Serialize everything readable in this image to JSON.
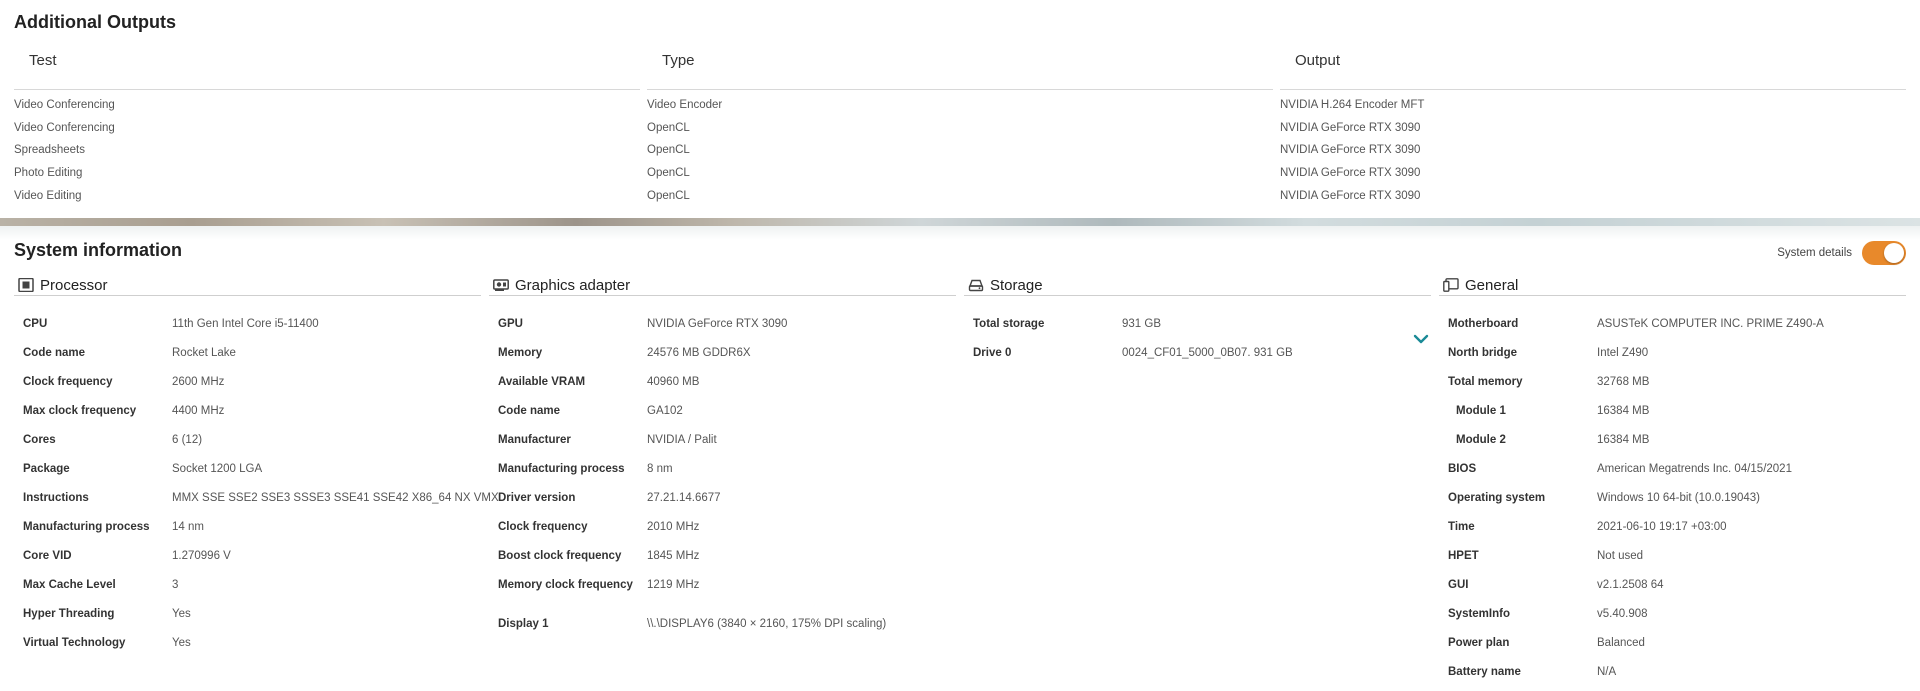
{
  "additional_outputs": {
    "title": "Additional Outputs",
    "headers": [
      "Test",
      "Type",
      "Output"
    ],
    "rows": [
      {
        "test": "Video Conferencing",
        "type": "Video Encoder",
        "output": "NVIDIA H.264 Encoder MFT"
      },
      {
        "test": "Video Conferencing",
        "type": "OpenCL",
        "output": "NVIDIA GeForce RTX 3090"
      },
      {
        "test": "Spreadsheets",
        "type": "OpenCL",
        "output": "NVIDIA GeForce RTX 3090"
      },
      {
        "test": "Photo Editing",
        "type": "OpenCL",
        "output": "NVIDIA GeForce RTX 3090"
      },
      {
        "test": "Video Editing",
        "type": "OpenCL",
        "output": "NVIDIA GeForce RTX 3090"
      }
    ]
  },
  "system_info": {
    "title": "System information",
    "details_toggle_label": "System details",
    "details_toggle_on": true,
    "accent_color": "#e8892b",
    "processor": {
      "title": "Processor",
      "icon": "cpu-icon",
      "rows": [
        {
          "k": "CPU",
          "v": "11th Gen Intel Core i5-11400"
        },
        {
          "k": "Code name",
          "v": "Rocket Lake"
        },
        {
          "k": "Clock frequency",
          "v": "2600 MHz"
        },
        {
          "k": "Max clock frequency",
          "v": "4400 MHz"
        },
        {
          "k": "Cores",
          "v": "6 (12)"
        },
        {
          "k": "Package",
          "v": "Socket 1200 LGA"
        },
        {
          "k": "Instructions",
          "v": "MMX SSE SSE2 SSE3 SSSE3 SSE41 SSE42 X86_64 NX VMX"
        },
        {
          "k": "Manufacturing process",
          "v": "14 nm"
        },
        {
          "k": "Core VID",
          "v": "1.270996 V"
        },
        {
          "k": "Max Cache Level",
          "v": "3"
        },
        {
          "k": "Hyper Threading",
          "v": "Yes"
        },
        {
          "k": "Virtual Technology",
          "v": "Yes"
        }
      ]
    },
    "graphics": {
      "title": "Graphics adapter",
      "icon": "gpu-icon",
      "rows": [
        {
          "k": "GPU",
          "v": "NVIDIA GeForce RTX 3090"
        },
        {
          "k": "Memory",
          "v": "24576 MB GDDR6X"
        },
        {
          "k": "Available VRAM",
          "v": "40960 MB"
        },
        {
          "k": "Code name",
          "v": "GA102"
        },
        {
          "k": "Manufacturer",
          "v": "NVIDIA / Palit"
        },
        {
          "k": "Manufacturing process",
          "v": "8 nm"
        },
        {
          "k": "Driver version",
          "v": "27.21.14.6677"
        },
        {
          "k": "Clock frequency",
          "v": "2010 MHz"
        },
        {
          "k": "Boost clock frequency",
          "v": "1845 MHz"
        },
        {
          "k": "Memory clock frequency",
          "v": "1219 MHz"
        },
        {
          "k": "Display 1",
          "v": "\\\\.\\DISPLAY6 (3840 × 2160, 175% DPI scaling)"
        }
      ]
    },
    "storage": {
      "title": "Storage",
      "icon": "drive-icon",
      "rows": [
        {
          "k": "Total storage",
          "v": "931 GB"
        },
        {
          "k": "Drive 0",
          "v": "0024_CF01_5000_0B07. 931 GB"
        }
      ],
      "expand_icon": "chevron-down-icon"
    },
    "general": {
      "title": "General",
      "icon": "general-icon",
      "rows": [
        {
          "k": "Motherboard",
          "v": "ASUSTeK COMPUTER INC. PRIME Z490-A"
        },
        {
          "k": "North bridge",
          "v": "Intel Z490"
        },
        {
          "k": "Total memory",
          "v": "32768 MB"
        },
        {
          "k": "Module 1",
          "v": "16384 MB"
        },
        {
          "k": "Module 2",
          "v": "16384 MB"
        },
        {
          "k": "BIOS",
          "v": "American Megatrends Inc. 04/15/2021"
        },
        {
          "k": "Operating system",
          "v": "Windows 10 64-bit (10.0.19043)"
        },
        {
          "k": "Time",
          "v": "2021-06-10 19:17 +03:00"
        },
        {
          "k": "HPET",
          "v": "Not used"
        },
        {
          "k": "GUI",
          "v": "v2.1.2508 64"
        },
        {
          "k": "SystemInfo",
          "v": "v5.40.908"
        },
        {
          "k": "Power plan",
          "v": "Balanced"
        },
        {
          "k": "Battery name",
          "v": "N/A"
        }
      ]
    }
  }
}
